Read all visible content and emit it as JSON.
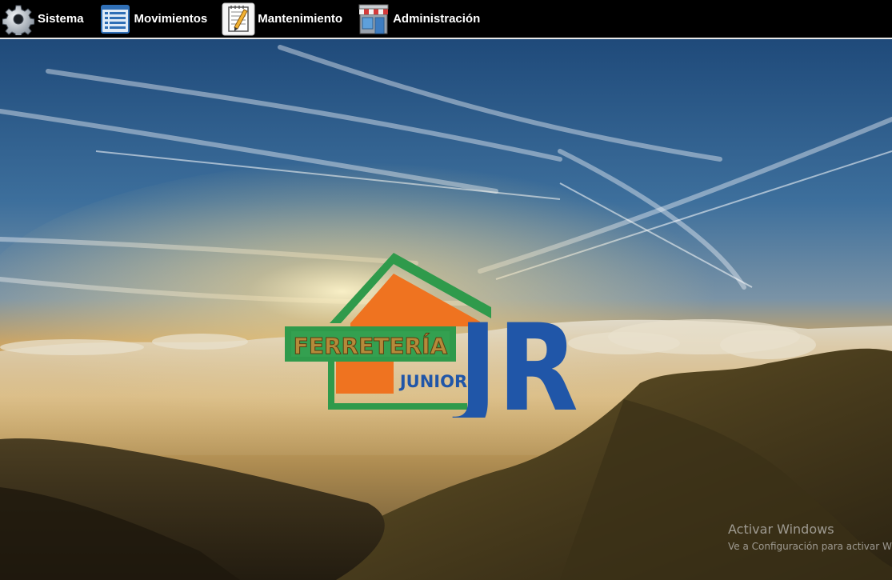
{
  "menu": {
    "items": [
      {
        "label": "Sistema",
        "icon": "gear-icon"
      },
      {
        "label": "Movimientos",
        "icon": "list-icon"
      },
      {
        "label": "Mantenimiento",
        "icon": "notepad-pencil-icon"
      },
      {
        "label": "Administración",
        "icon": "store-icon"
      }
    ]
  },
  "logo": {
    "line1": "FERRETERÍA",
    "line2": "JUNIOR",
    "initials": "JR",
    "colors": {
      "green": "#2f9a4b",
      "orange": "#ef7320",
      "blue": "#2056a8"
    }
  },
  "watermark": {
    "title": "Activar Windows",
    "subtitle": "Ve a Configuración para activar Windows."
  }
}
